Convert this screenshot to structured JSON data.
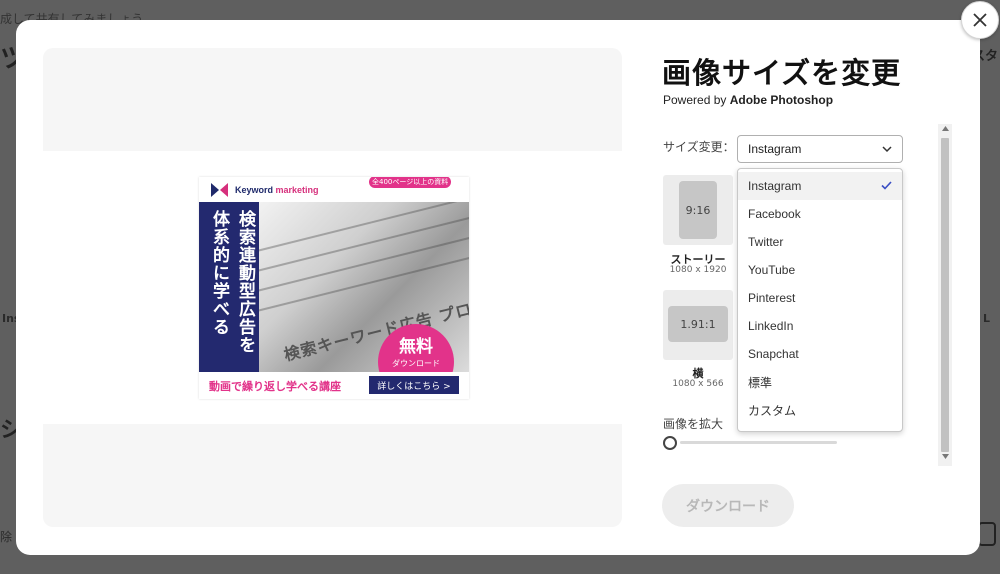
{
  "background": {
    "top_fragment": "成して共有してみましょう",
    "big_fragment": "ツ",
    "left_label": "Ins",
    "left_heading": "シ",
    "bottom_left": "除",
    "right_heading": "スタ",
    "right_label": "L"
  },
  "modal": {
    "title": "画像サイズを変更",
    "powered_prefix": "Powered by ",
    "powered_brand": "Adobe Photoshop",
    "size_label": "サイズ変更：",
    "select_value": "Instagram",
    "presets": [
      {
        "ratio": "9:16",
        "name": "ストーリー",
        "dims": "1080 x 1920"
      },
      {
        "ratio": "1.91:1",
        "name": "横",
        "dims": "1080 x 566"
      }
    ],
    "zoom_label": "画像を拡大",
    "zoom_value": 0,
    "download_label": "ダウンロード",
    "dropdown_options": [
      "Instagram",
      "Facebook",
      "Twitter",
      "YouTube",
      "Pinterest",
      "LinkedIn",
      "Snapchat",
      "標準",
      "カスタム"
    ],
    "dropdown_selected": "Instagram"
  },
  "banner": {
    "logo_word1": "Keyword",
    "logo_word2": " marketing",
    "side_col1": "検索連動型広告を",
    "side_col2": "体系的に学べる",
    "photo_text": "検索キーワード広告 プロフェッショナル養",
    "free_pre": "全400ページ以上の資料",
    "free_big": "無料",
    "free_small": "ダウンロード",
    "bottom_text": "動画で繰り返し学べる講座",
    "bottom_button": "詳しくはこちら >"
  },
  "colors": {
    "banner_navy": "#23296f",
    "banner_pink": "#e2338a",
    "check_blue": "#3b4fc4"
  }
}
